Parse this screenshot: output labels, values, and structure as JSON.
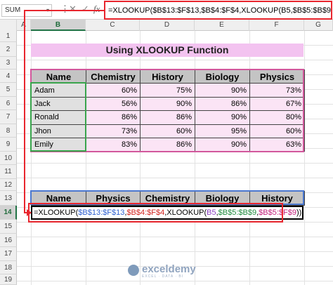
{
  "formula_bar": {
    "name_box": "SUM",
    "icons": [
      "more-icon",
      "cancel-icon",
      "confirm-icon",
      "function-icon"
    ],
    "fx_label": "fx",
    "formula": "=XLOOKUP($B$13:$F$13,$B$4:$F$4,XLOOKUP(B5,$B$5:$B$9,$B$5:$F$9))"
  },
  "columns": [
    "A",
    "B",
    "C",
    "D",
    "E",
    "F",
    "G"
  ],
  "rows": [
    "1",
    "2",
    "3",
    "4",
    "5",
    "6",
    "7",
    "8",
    "9",
    "10",
    "11",
    "12",
    "13",
    "14",
    "15",
    "16",
    "17",
    "18",
    "19"
  ],
  "title": "Using XLOOKUP Function",
  "table1": {
    "headers": [
      "Name",
      "Chemistry",
      "History",
      "Biology",
      "Physics"
    ],
    "rows": [
      [
        "Adam",
        "60%",
        "75%",
        "90%",
        "73%"
      ],
      [
        "Jack",
        "56%",
        "90%",
        "86%",
        "67%"
      ],
      [
        "Ronald",
        "86%",
        "86%",
        "90%",
        "80%"
      ],
      [
        "Jhon",
        "73%",
        "60%",
        "95%",
        "60%"
      ],
      [
        "Emily",
        "83%",
        "86%",
        "90%",
        "63%"
      ]
    ]
  },
  "table2": {
    "headers": [
      "Name",
      "Physics",
      "Chemistry",
      "Biology",
      "History"
    ]
  },
  "edit_cell": {
    "p1": "=XLOOKUP(",
    "p2": "$B$13:$F$13",
    "p3": ",",
    "p4": "$B$4:$F$4",
    "p5": ",XLOOKUP(",
    "p6": "B5",
    "p7": ",",
    "p8": "$B$5:$B$9",
    "p9": ",",
    "p10": "$B$5:$F$9",
    "p11": "))"
  },
  "watermark": {
    "name": "exceldemy",
    "tagline": "EXCEL · DATA · BI"
  },
  "colors": {
    "accent_red": "#e8262e",
    "title_bg": "#f3c3f0",
    "cell_pink": "#fbe4f5",
    "ref_blue": "#2e5fd1",
    "ref_red": "#d2231f",
    "ref_purple": "#8a3ec0",
    "ref_green": "#1f8a3c",
    "ref_magenta": "#c2207a"
  }
}
